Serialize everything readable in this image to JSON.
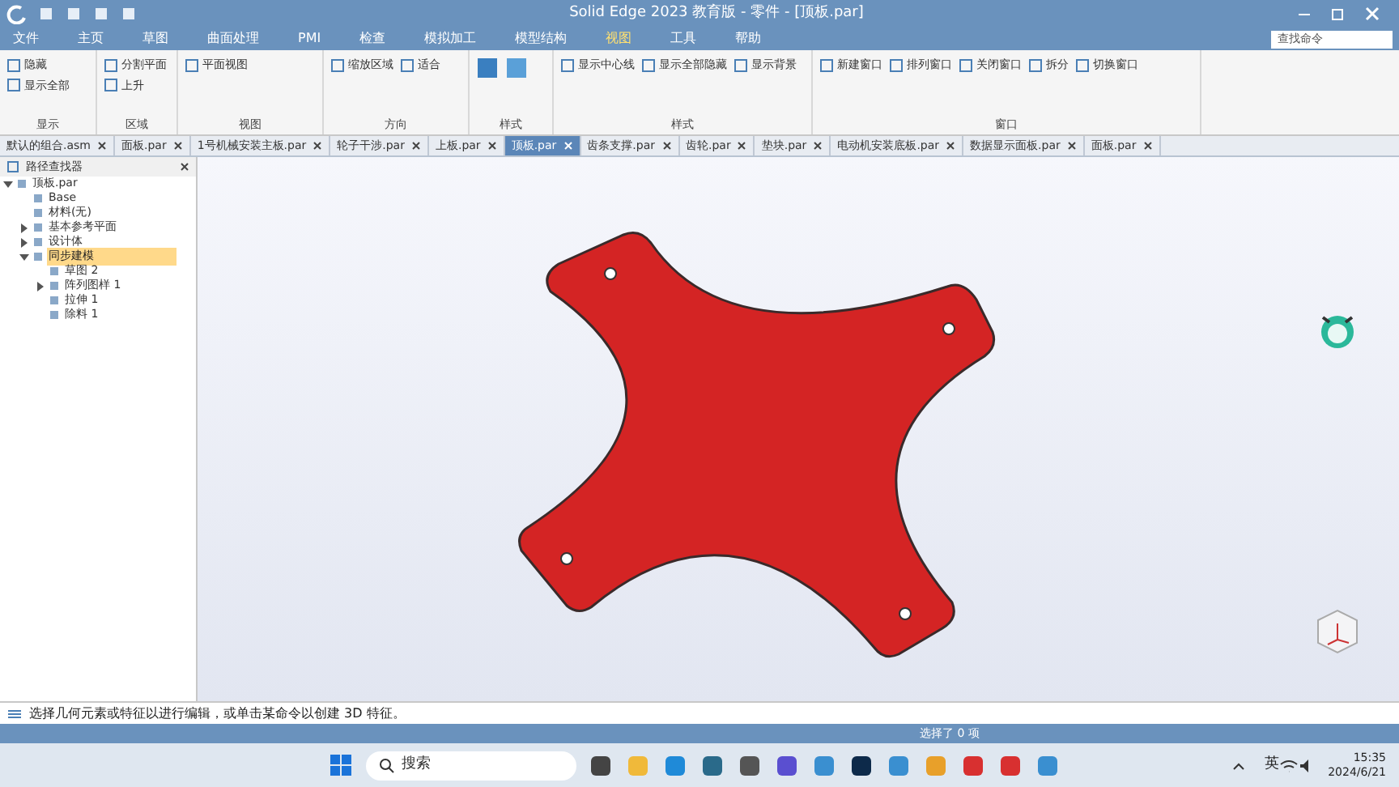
{
  "window": {
    "title": "Solid Edge 2023 教育版 - 零件 - [顶板.par]",
    "search_placeholder": "查找命令"
  },
  "menu": [
    {
      "label": "文件",
      "selected": false
    },
    {
      "label": "主页",
      "selected": false
    },
    {
      "label": "草图",
      "selected": false
    },
    {
      "label": "曲面处理",
      "selected": false
    },
    {
      "label": "PMI",
      "selected": false
    },
    {
      "label": "检查",
      "selected": false
    },
    {
      "label": "模拟加工",
      "selected": false
    },
    {
      "label": "模型结构",
      "selected": false
    },
    {
      "label": "视图",
      "selected": true
    },
    {
      "label": "工具",
      "selected": false
    },
    {
      "label": "帮助",
      "selected": false
    }
  ],
  "ribbon_groups": [
    {
      "label": "显示",
      "buttons": [
        "隐藏",
        "显示全部"
      ]
    },
    {
      "label": "区域",
      "buttons": [
        "分割平面",
        "上升"
      ]
    },
    {
      "label": "视图",
      "buttons": [
        "平面视图"
      ]
    },
    {
      "label": "方向",
      "buttons": [
        "缩放区域",
        "适合"
      ]
    },
    {
      "label": "样式"
    },
    {
      "label": "样式",
      "buttons": [
        "显示中心线",
        "显示全部隐藏",
        "显示背景"
      ]
    },
    {
      "label": "窗口",
      "buttons": [
        "新建窗口",
        "排列窗口",
        "关闭窗口",
        "拆分",
        "切换窗口"
      ]
    }
  ],
  "doc_tabs": [
    {
      "label": "默认的组合.asm",
      "selected": false
    },
    {
      "label": "面板.par",
      "selected": false
    },
    {
      "label": "1号机械安装主板.par",
      "selected": false
    },
    {
      "label": "轮子干涉.par",
      "selected": false
    },
    {
      "label": "上板.par",
      "selected": false
    },
    {
      "label": "顶板.par",
      "selected": true
    },
    {
      "label": "齿条支撑.par",
      "selected": false
    },
    {
      "label": "齿轮.par",
      "selected": false
    },
    {
      "label": "垫块.par",
      "selected": false
    },
    {
      "label": "电动机安装底板.par",
      "selected": false
    },
    {
      "label": "数据显示面板.par",
      "selected": false
    },
    {
      "label": "面板.par",
      "selected": false
    }
  ],
  "pathfinder": {
    "title": "路径查找器",
    "tree": [
      {
        "label": "顶板.par",
        "expanded": true,
        "selected": false,
        "children": [
          {
            "label": "Base",
            "selected": false
          },
          {
            "label": "材料(无)",
            "selected": false
          },
          {
            "label": "基本参考平面",
            "expanded": false,
            "selected": false
          },
          {
            "label": "设计体",
            "expanded": false,
            "selected": false
          },
          {
            "label": "同步建模",
            "expanded": true,
            "selected": true,
            "children": [
              {
                "label": "草图 2",
                "selected": false
              },
              {
                "label": "阵列图样 1",
                "expanded": false,
                "selected": false
              },
              {
                "label": "拉伸 1",
                "selected": false
              },
              {
                "label": "除料 1",
                "selected": false
              }
            ]
          }
        ]
      }
    ]
  },
  "prompt": "选择几何元素或特征以进行编辑，或单击某命令以创建 3D 特征。",
  "status_bar": {
    "selection": "选择了 0 项"
  },
  "taskbar": {
    "search": "搜索",
    "ime": "英",
    "time": "15:35",
    "date": "2024/6/21"
  }
}
